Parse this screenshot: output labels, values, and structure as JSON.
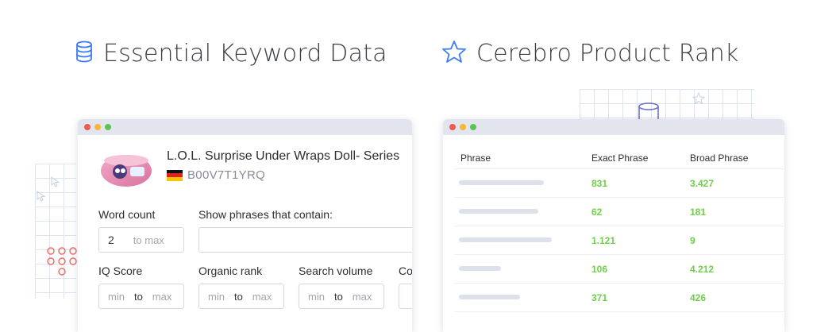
{
  "left_section": {
    "title": "Essential Keyword Data",
    "icon": "database-icon"
  },
  "right_section": {
    "title": "Cerebro Product Rank",
    "icon": "star-icon"
  },
  "colors": {
    "accent_blue": "#3d7bf0",
    "green": "#6fcf4a",
    "red": "#ee5a52"
  },
  "product": {
    "title": "L.O.L. Surprise Under Wraps Doll- Series",
    "asin": "B00V7T1YRQ",
    "marketplace_flag": "germany-flag-icon"
  },
  "filters": {
    "word_count": {
      "label": "Word count",
      "value": "2",
      "max_placeholder": "to max"
    },
    "phrases": {
      "label": "Show phrases that contain:"
    },
    "iq_score": {
      "label": "IQ Score",
      "min": "min",
      "to": "to",
      "max": "max"
    },
    "organic_rank": {
      "label": "Organic rank",
      "min": "min",
      "to": "to",
      "max": "max"
    },
    "search_volume": {
      "label": "Search volume",
      "min": "min",
      "to": "to",
      "max": "max"
    },
    "truncated_label": "Co"
  },
  "rank_table": {
    "columns": [
      "Phrase",
      "Exact Phrase",
      "Broad Phrase"
    ],
    "rows": [
      {
        "exact": "831",
        "broad": "3.427"
      },
      {
        "exact": "62",
        "broad": "181"
      },
      {
        "exact": "1.121",
        "broad": "9"
      },
      {
        "exact": "106",
        "broad": "4.212"
      },
      {
        "exact": "371",
        "broad": "426"
      }
    ]
  }
}
